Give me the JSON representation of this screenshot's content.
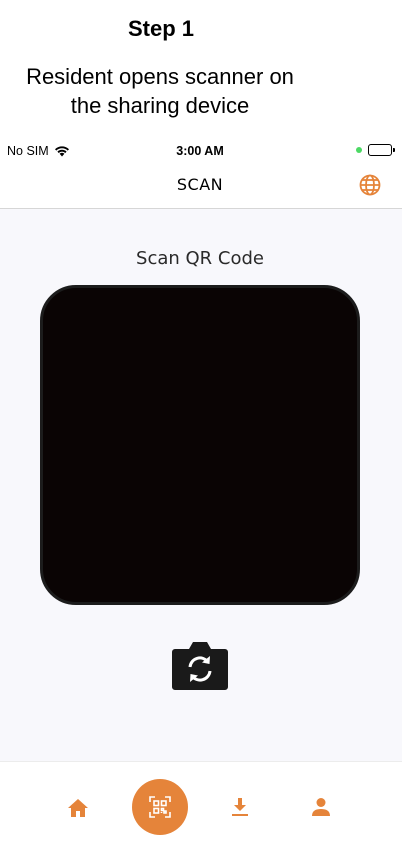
{
  "caption": {
    "title": "Step 1",
    "description_line1": "Resident opens scanner on",
    "description_line2": "the sharing device"
  },
  "status_bar": {
    "carrier": "No SIM",
    "time": "3:00 AM"
  },
  "header": {
    "title": "SCAN",
    "language_icon": "globe-icon"
  },
  "scanner": {
    "label": "Scan QR Code",
    "flip_icon": "camera-flip-icon"
  },
  "bottom_nav": {
    "items": [
      {
        "icon": "home-icon"
      },
      {
        "icon": "qr-scan-icon",
        "active": true
      },
      {
        "icon": "download-icon"
      },
      {
        "icon": "profile-icon"
      }
    ]
  },
  "colors": {
    "accent": "#e5843a",
    "camera_bg": "#0a0404",
    "screen_bg": "#f8f8fc"
  }
}
